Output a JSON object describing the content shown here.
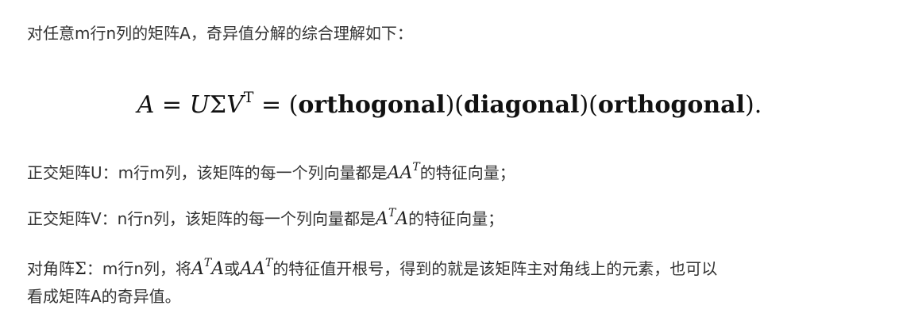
{
  "intro": "对任意m行n列的矩阵A，奇异值分解的综合理解如下：",
  "formula": {
    "A": "A",
    "eq1": "=",
    "U": "U",
    "Sigma": "Σ",
    "V": "V",
    "T": "T",
    "eq2": "=",
    "open1": "(",
    "orthogonal1": "orthogonal",
    "close1": ")",
    "open2": "(",
    "diagonal": "diagonal",
    "close2": ")",
    "open3": "(",
    "orthogonal2": "orthogonal",
    "close3": ")",
    "period": "."
  },
  "u_line": {
    "prefix": "正交矩阵U：m行m列，该矩阵的每一个列向量都是",
    "math_base": "AA",
    "math_sup": "T",
    "suffix": "的特征向量；"
  },
  "v_line": {
    "prefix": "正交矩阵V：n行n列，该矩阵的每一个列向量都是",
    "math_a": "A",
    "math_sup": "T",
    "math_b": "A",
    "suffix": "的特征向量；"
  },
  "sigma_line": {
    "prefix": "对角阵",
    "sigma": "Σ",
    "part1": "：m行n列，将",
    "m1_a": "A",
    "m1_sup": "T",
    "m1_b": "A",
    "or": "或",
    "m2_base": "AA",
    "m2_sup": "T",
    "part2": "的特征值开根号，得到的就是该矩阵主对角线上的元素，也可以",
    "line2": "看成矩阵A的奇异值。"
  }
}
